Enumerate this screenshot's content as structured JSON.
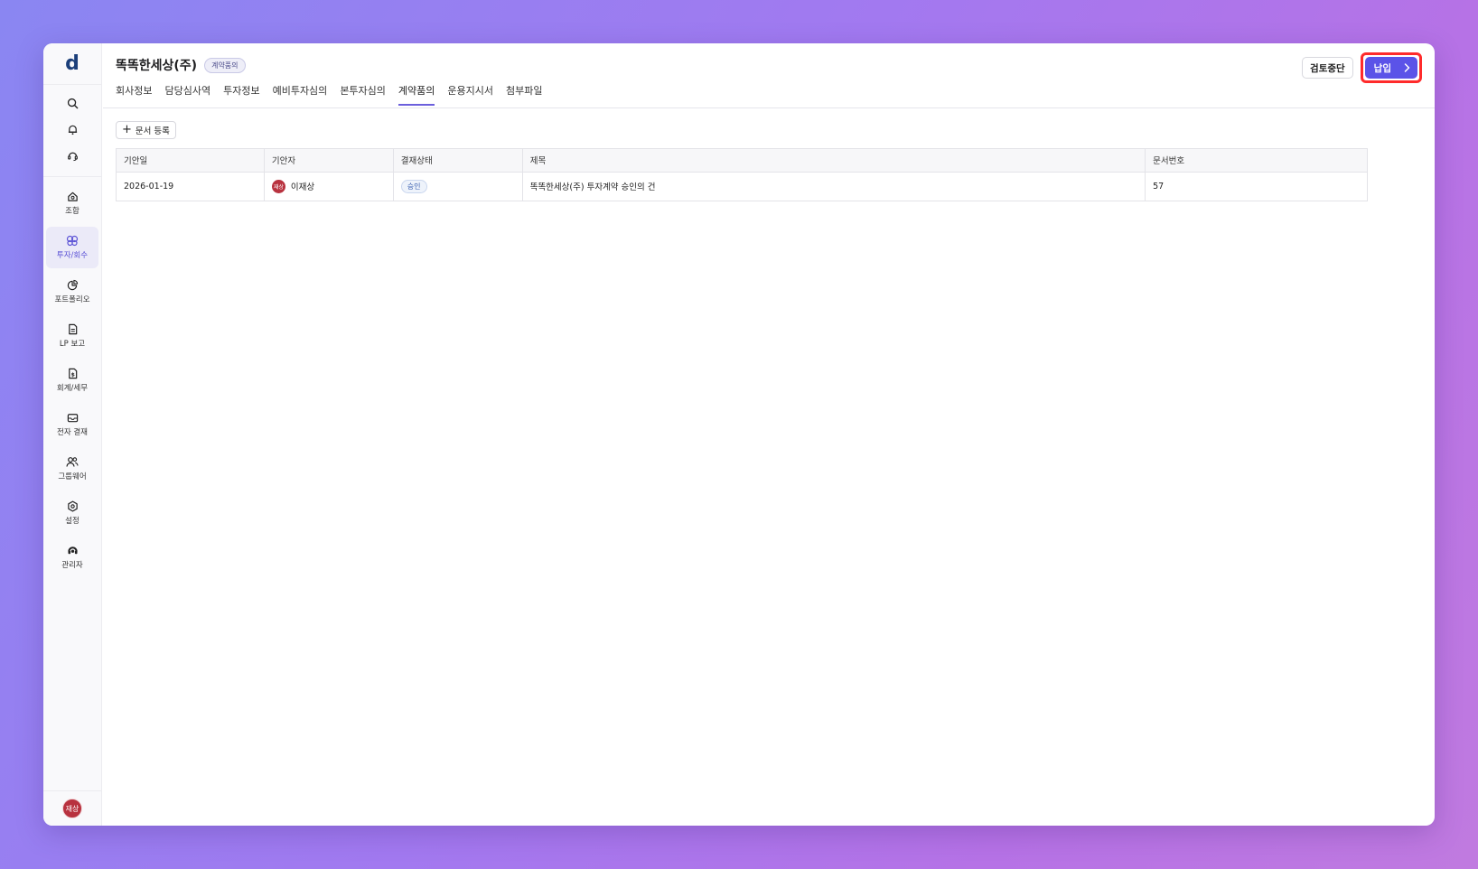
{
  "app": {
    "logo": "d"
  },
  "sidebar": {
    "tools": [
      {
        "icon": "search-icon"
      },
      {
        "icon": "bell-icon"
      },
      {
        "icon": "headset-icon"
      }
    ],
    "items": [
      {
        "label": "조합",
        "icon": "fund-icon",
        "active": false
      },
      {
        "label": "투자/회수",
        "icon": "investment-icon",
        "active": true
      },
      {
        "label": "포트폴리오",
        "icon": "pie-chart-icon",
        "active": false
      },
      {
        "label": "LP 보고",
        "icon": "report-icon",
        "active": false
      },
      {
        "label": "회계/세무",
        "icon": "accounting-icon",
        "active": false
      },
      {
        "label": "전자 결재",
        "icon": "inbox-icon",
        "active": false
      },
      {
        "label": "그룹웨어",
        "icon": "users-icon",
        "active": false
      },
      {
        "label": "설정",
        "icon": "settings-icon",
        "active": false
      },
      {
        "label": "관리자",
        "icon": "admin-icon",
        "active": false
      }
    ],
    "user_avatar": "재상"
  },
  "header": {
    "company_name": "똑똑한세상(주)",
    "stage_badge": "계약품의",
    "tabs": [
      {
        "label": "회사정보",
        "active": false
      },
      {
        "label": "담당심사역",
        "active": false
      },
      {
        "label": "투자정보",
        "active": false
      },
      {
        "label": "예비투자심의",
        "active": false
      },
      {
        "label": "본투자심의",
        "active": false
      },
      {
        "label": "계약품의",
        "active": true
      },
      {
        "label": "운용지시서",
        "active": false
      },
      {
        "label": "첨부파일",
        "active": false
      }
    ],
    "stop_review_label": "검토중단",
    "primary_label": "납입"
  },
  "content": {
    "add_document_label": "문서 등록",
    "table": {
      "columns": [
        "기안일",
        "기안자",
        "결재상태",
        "제목",
        "문서번호"
      ],
      "rows": [
        {
          "date": "2026-01-19",
          "drafter_avatar": "재상",
          "drafter": "이재상",
          "status": "승인",
          "title": "똑똑한세상(주) 투자계약 승인의 건",
          "doc_no": "57"
        }
      ]
    }
  },
  "colors": {
    "accent": "#5b53e8",
    "highlight_outline": "#ff2b2b",
    "avatar": "#b8323f"
  }
}
